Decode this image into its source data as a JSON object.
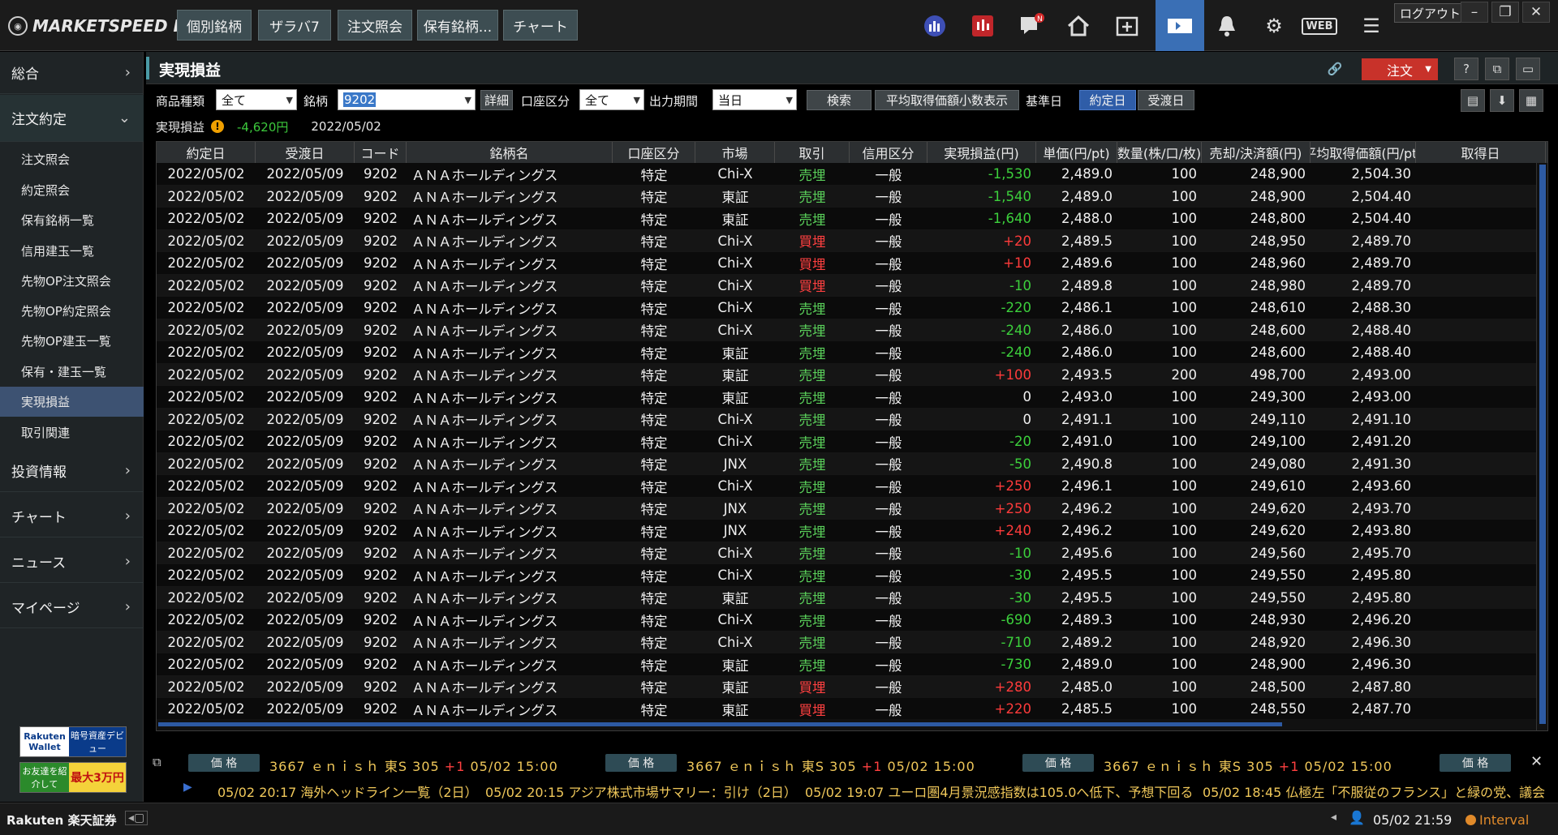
{
  "app": {
    "logo": "MARKETSPEED II",
    "tabs": [
      "個別銘柄",
      "ザラバ7",
      "注文照会",
      "保有銘柄...",
      "チャート"
    ],
    "logout": "ログアウト",
    "web_label": "WEB",
    "notification_badge": "N"
  },
  "sidebar": {
    "sections": [
      {
        "label": "総合",
        "icon": "chevron-right"
      },
      {
        "label": "注文約定",
        "icon": "chevron-down"
      },
      {
        "label": "投資情報",
        "icon": "chevron-right"
      },
      {
        "label": "チャート",
        "icon": "chevron-right"
      },
      {
        "label": "ニュース",
        "icon": "chevron-right"
      },
      {
        "label": "マイページ",
        "icon": "chevron-right"
      }
    ],
    "subitems": [
      "注文照会",
      "約定照会",
      "保有銘柄一覧",
      "信用建玉一覧",
      "先物OP注文照会",
      "先物OP約定照会",
      "先物OP建玉一覧",
      "保有・建玉一覧",
      "実現損益",
      "取引関連"
    ],
    "active_subitem": "実現損益",
    "banner1_a": "Rakuten Wallet",
    "banner1_b": "暗号資産デビュー",
    "banner2_a": "お友達を紹介して",
    "banner2_b": "最大3万円"
  },
  "main": {
    "title": "実現損益",
    "order_button": "注文",
    "filters": {
      "product_label": "商品種類",
      "product_value": "全て",
      "symbol_label": "銘柄",
      "symbol_value": "9202",
      "detail_button": "詳細",
      "account_label": "口座区分",
      "account_value": "全て",
      "period_label": "出力期間",
      "period_value": "当日",
      "search_button": "検索",
      "avg_decimal_button": "平均取得価額小数表示",
      "base_date_label": "基準日",
      "trade_date_button": "約定日",
      "settle_date_button": "受渡日"
    },
    "summary": {
      "label": "実現損益",
      "value": "-4,620円",
      "date": "2022/05/02"
    }
  },
  "table": {
    "columns": [
      "約定日",
      "受渡日",
      "コード",
      "銘柄名",
      "口座区分",
      "市場",
      "取引",
      "信用区分",
      "実現損益(円)",
      "単価(円/pt)",
      "数量(株/口/枚)",
      "売却/決済額(円)",
      "平均取得価額(円/pt)",
      "取得日"
    ],
    "rows": [
      [
        "2022/05/02",
        "2022/05/09",
        "9202",
        "ＡＮＡホールディングス",
        "特定",
        "Chi-X",
        "売埋",
        "一般",
        "-1,530",
        "2,489.0",
        "100",
        "248,900",
        "2,504.30"
      ],
      [
        "2022/05/02",
        "2022/05/09",
        "9202",
        "ＡＮＡホールディングス",
        "特定",
        "東証",
        "売埋",
        "一般",
        "-1,540",
        "2,489.0",
        "100",
        "248,900",
        "2,504.40"
      ],
      [
        "2022/05/02",
        "2022/05/09",
        "9202",
        "ＡＮＡホールディングス",
        "特定",
        "東証",
        "売埋",
        "一般",
        "-1,640",
        "2,488.0",
        "100",
        "248,800",
        "2,504.40"
      ],
      [
        "2022/05/02",
        "2022/05/09",
        "9202",
        "ＡＮＡホールディングス",
        "特定",
        "Chi-X",
        "買埋",
        "一般",
        "+20",
        "2,489.5",
        "100",
        "248,950",
        "2,489.70"
      ],
      [
        "2022/05/02",
        "2022/05/09",
        "9202",
        "ＡＮＡホールディングス",
        "特定",
        "Chi-X",
        "買埋",
        "一般",
        "+10",
        "2,489.6",
        "100",
        "248,960",
        "2,489.70"
      ],
      [
        "2022/05/02",
        "2022/05/09",
        "9202",
        "ＡＮＡホールディングス",
        "特定",
        "Chi-X",
        "買埋",
        "一般",
        "-10",
        "2,489.8",
        "100",
        "248,980",
        "2,489.70"
      ],
      [
        "2022/05/02",
        "2022/05/09",
        "9202",
        "ＡＮＡホールディングス",
        "特定",
        "Chi-X",
        "売埋",
        "一般",
        "-220",
        "2,486.1",
        "100",
        "248,610",
        "2,488.30"
      ],
      [
        "2022/05/02",
        "2022/05/09",
        "9202",
        "ＡＮＡホールディングス",
        "特定",
        "Chi-X",
        "売埋",
        "一般",
        "-240",
        "2,486.0",
        "100",
        "248,600",
        "2,488.40"
      ],
      [
        "2022/05/02",
        "2022/05/09",
        "9202",
        "ＡＮＡホールディングス",
        "特定",
        "東証",
        "売埋",
        "一般",
        "-240",
        "2,486.0",
        "100",
        "248,600",
        "2,488.40"
      ],
      [
        "2022/05/02",
        "2022/05/09",
        "9202",
        "ＡＮＡホールディングス",
        "特定",
        "東証",
        "売埋",
        "一般",
        "+100",
        "2,493.5",
        "200",
        "498,700",
        "2,493.00"
      ],
      [
        "2022/05/02",
        "2022/05/09",
        "9202",
        "ＡＮＡホールディングス",
        "特定",
        "東証",
        "売埋",
        "一般",
        "0",
        "2,493.0",
        "100",
        "249,300",
        "2,493.00"
      ],
      [
        "2022/05/02",
        "2022/05/09",
        "9202",
        "ＡＮＡホールディングス",
        "特定",
        "Chi-X",
        "売埋",
        "一般",
        "0",
        "2,491.1",
        "100",
        "249,110",
        "2,491.10"
      ],
      [
        "2022/05/02",
        "2022/05/09",
        "9202",
        "ＡＮＡホールディングス",
        "特定",
        "Chi-X",
        "売埋",
        "一般",
        "-20",
        "2,491.0",
        "100",
        "249,100",
        "2,491.20"
      ],
      [
        "2022/05/02",
        "2022/05/09",
        "9202",
        "ＡＮＡホールディングス",
        "特定",
        "JNX",
        "売埋",
        "一般",
        "-50",
        "2,490.8",
        "100",
        "249,080",
        "2,491.30"
      ],
      [
        "2022/05/02",
        "2022/05/09",
        "9202",
        "ＡＮＡホールディングス",
        "特定",
        "Chi-X",
        "売埋",
        "一般",
        "+250",
        "2,496.1",
        "100",
        "249,610",
        "2,493.60"
      ],
      [
        "2022/05/02",
        "2022/05/09",
        "9202",
        "ＡＮＡホールディングス",
        "特定",
        "JNX",
        "売埋",
        "一般",
        "+250",
        "2,496.2",
        "100",
        "249,620",
        "2,493.70"
      ],
      [
        "2022/05/02",
        "2022/05/09",
        "9202",
        "ＡＮＡホールディングス",
        "特定",
        "JNX",
        "売埋",
        "一般",
        "+240",
        "2,496.2",
        "100",
        "249,620",
        "2,493.80"
      ],
      [
        "2022/05/02",
        "2022/05/09",
        "9202",
        "ＡＮＡホールディングス",
        "特定",
        "Chi-X",
        "売埋",
        "一般",
        "-10",
        "2,495.6",
        "100",
        "249,560",
        "2,495.70"
      ],
      [
        "2022/05/02",
        "2022/05/09",
        "9202",
        "ＡＮＡホールディングス",
        "特定",
        "Chi-X",
        "売埋",
        "一般",
        "-30",
        "2,495.5",
        "100",
        "249,550",
        "2,495.80"
      ],
      [
        "2022/05/02",
        "2022/05/09",
        "9202",
        "ＡＮＡホールディングス",
        "特定",
        "東証",
        "売埋",
        "一般",
        "-30",
        "2,495.5",
        "100",
        "249,550",
        "2,495.80"
      ],
      [
        "2022/05/02",
        "2022/05/09",
        "9202",
        "ＡＮＡホールディングス",
        "特定",
        "Chi-X",
        "売埋",
        "一般",
        "-690",
        "2,489.3",
        "100",
        "248,930",
        "2,496.20"
      ],
      [
        "2022/05/02",
        "2022/05/09",
        "9202",
        "ＡＮＡホールディングス",
        "特定",
        "Chi-X",
        "売埋",
        "一般",
        "-710",
        "2,489.2",
        "100",
        "248,920",
        "2,496.30"
      ],
      [
        "2022/05/02",
        "2022/05/09",
        "9202",
        "ＡＮＡホールディングス",
        "特定",
        "東証",
        "売埋",
        "一般",
        "-730",
        "2,489.0",
        "100",
        "248,900",
        "2,496.30"
      ],
      [
        "2022/05/02",
        "2022/05/09",
        "9202",
        "ＡＮＡホールディングス",
        "特定",
        "東証",
        "買埋",
        "一般",
        "+280",
        "2,485.0",
        "100",
        "248,500",
        "2,487.80"
      ],
      [
        "2022/05/02",
        "2022/05/09",
        "9202",
        "ＡＮＡホールディングス",
        "特定",
        "東証",
        "買埋",
        "一般",
        "+220",
        "2,485.5",
        "100",
        "248,550",
        "2,487.70"
      ]
    ]
  },
  "ticker": {
    "tag": "価 格",
    "quote_main": "3667 ｅｎｉｓｈ 東S 305",
    "quote_change": "+1",
    "quote_time": "05/02 15:00",
    "news": [
      "05/02 20:17  海外ヘッドライン一覧（2日）",
      "05/02 20:15  アジア株式市場サマリー：引け（2日）",
      "05/02 19:07  ユーロ圏4月景況感指数は105.0へ低下、予想下回る",
      "05/02 18:45  仏極左「不服従のフランス」と緑の党、議会"
    ]
  },
  "status": {
    "brand": "Rakuten 楽天証券",
    "clock": "05/02 21:59",
    "interval": "Interval"
  }
}
